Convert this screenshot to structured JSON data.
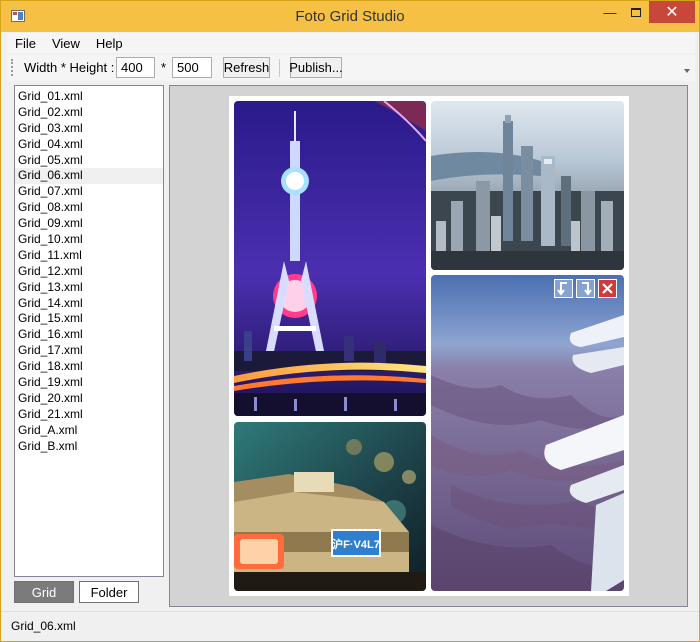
{
  "window": {
    "title": "Foto Grid Studio"
  },
  "menu": {
    "file": "File",
    "view": "View",
    "help": "Help"
  },
  "toolbar": {
    "size_label": "Width * Height :",
    "width_value": "400",
    "times_symbol": "*",
    "height_value": "500",
    "refresh_label": "Refresh",
    "publish_label": "Publish..."
  },
  "files": [
    "Grid_01.xml",
    "Grid_02.xml",
    "Grid_03.xml",
    "Grid_04.xml",
    "Grid_05.xml",
    "Grid_06.xml",
    "Grid_07.xml",
    "Grid_08.xml",
    "Grid_09.xml",
    "Grid_10.xml",
    "Grid_11.xml",
    "Grid_12.xml",
    "Grid_13.xml",
    "Grid_14.xml",
    "Grid_15.xml",
    "Grid_16.xml",
    "Grid_17.xml",
    "Grid_18.xml",
    "Grid_19.xml",
    "Grid_20.xml",
    "Grid_21.xml",
    "Grid_A.xml",
    "Grid_B.xml"
  ],
  "selected_file": "Grid_06.xml",
  "tabs": {
    "grid": "Grid",
    "folder": "Folder",
    "active": "Grid"
  },
  "status": {
    "text": "Grid_06.xml"
  },
  "taxi_plate": "沪F·V4L7",
  "colors": {
    "titlebar": "#f5c044",
    "close_button": "#c7473a",
    "delete_button": "#d23a3a"
  }
}
